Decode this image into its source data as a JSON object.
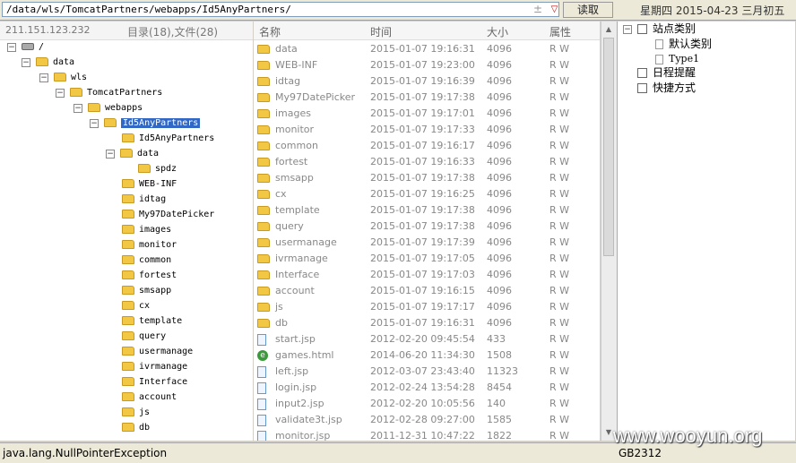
{
  "toolbar": {
    "path": "/data/wls/TomcatPartners/webapps/Id5AnyPartners/",
    "path_plus": "±",
    "dropdown_arrow": "▽",
    "read_button": "读取",
    "date": "星期四 2015-04-23 三月初五"
  },
  "left": {
    "ip": "211.151.123.232",
    "dir_info": "目录(18),文件(28)",
    "tree": [
      {
        "label": "/",
        "icon": "drive"
      },
      {
        "label": "data",
        "icon": "folder"
      },
      {
        "label": "wls",
        "icon": "folder"
      },
      {
        "label": "TomcatPartners",
        "icon": "folder"
      },
      {
        "label": "webapps",
        "icon": "folder"
      },
      {
        "label": "Id5AnyPartners",
        "icon": "folder",
        "selected": true
      },
      {
        "label": "Id5AnyPartners",
        "icon": "folder"
      },
      {
        "label": "data",
        "icon": "folder"
      },
      {
        "label": "spdz",
        "icon": "folder"
      },
      {
        "label": "WEB-INF",
        "icon": "folder"
      },
      {
        "label": "idtag",
        "icon": "folder"
      },
      {
        "label": "My97DatePicker",
        "icon": "folder"
      },
      {
        "label": "images",
        "icon": "folder"
      },
      {
        "label": "monitor",
        "icon": "folder"
      },
      {
        "label": "common",
        "icon": "folder"
      },
      {
        "label": "fortest",
        "icon": "folder"
      },
      {
        "label": "smsapp",
        "icon": "folder"
      },
      {
        "label": "cx",
        "icon": "folder"
      },
      {
        "label": "template",
        "icon": "folder"
      },
      {
        "label": "query",
        "icon": "folder"
      },
      {
        "label": "usermanage",
        "icon": "folder"
      },
      {
        "label": "ivrmanage",
        "icon": "folder"
      },
      {
        "label": "Interface",
        "icon": "folder"
      },
      {
        "label": "account",
        "icon": "folder"
      },
      {
        "label": "js",
        "icon": "folder"
      },
      {
        "label": "db",
        "icon": "folder"
      }
    ]
  },
  "files": {
    "columns": {
      "name": "名称",
      "time": "时间",
      "size": "大小",
      "attr": "属性"
    },
    "rows": [
      {
        "name": "data",
        "time": "2015-01-07 19:16:31",
        "size": "4096",
        "attr": "R W",
        "icon": "folder"
      },
      {
        "name": "WEB-INF",
        "time": "2015-01-07 19:23:00",
        "size": "4096",
        "attr": "R W",
        "icon": "folder"
      },
      {
        "name": "idtag",
        "time": "2015-01-07 19:16:39",
        "size": "4096",
        "attr": "R W",
        "icon": "folder"
      },
      {
        "name": "My97DatePicker",
        "time": "2015-01-07 19:17:38",
        "size": "4096",
        "attr": "R W",
        "icon": "folder"
      },
      {
        "name": "images",
        "time": "2015-01-07 19:17:01",
        "size": "4096",
        "attr": "R W",
        "icon": "folder"
      },
      {
        "name": "monitor",
        "time": "2015-01-07 19:17:33",
        "size": "4096",
        "attr": "R W",
        "icon": "folder"
      },
      {
        "name": "common",
        "time": "2015-01-07 19:16:17",
        "size": "4096",
        "attr": "R W",
        "icon": "folder"
      },
      {
        "name": "fortest",
        "time": "2015-01-07 19:16:33",
        "size": "4096",
        "attr": "R W",
        "icon": "folder"
      },
      {
        "name": "smsapp",
        "time": "2015-01-07 19:17:38",
        "size": "4096",
        "attr": "R W",
        "icon": "folder"
      },
      {
        "name": "cx",
        "time": "2015-01-07 19:16:25",
        "size": "4096",
        "attr": "R W",
        "icon": "folder"
      },
      {
        "name": "template",
        "time": "2015-01-07 19:17:38",
        "size": "4096",
        "attr": "R W",
        "icon": "folder"
      },
      {
        "name": "query",
        "time": "2015-01-07 19:17:38",
        "size": "4096",
        "attr": "R W",
        "icon": "folder"
      },
      {
        "name": "usermanage",
        "time": "2015-01-07 19:17:39",
        "size": "4096",
        "attr": "R W",
        "icon": "folder"
      },
      {
        "name": "ivrmanage",
        "time": "2015-01-07 19:17:05",
        "size": "4096",
        "attr": "R W",
        "icon": "folder"
      },
      {
        "name": "Interface",
        "time": "2015-01-07 19:17:03",
        "size": "4096",
        "attr": "R W",
        "icon": "folder"
      },
      {
        "name": "account",
        "time": "2015-01-07 19:16:15",
        "size": "4096",
        "attr": "R W",
        "icon": "folder"
      },
      {
        "name": "js",
        "time": "2015-01-07 19:17:17",
        "size": "4096",
        "attr": "R W",
        "icon": "folder"
      },
      {
        "name": "db",
        "time": "2015-01-07 19:16:31",
        "size": "4096",
        "attr": "R W",
        "icon": "folder"
      },
      {
        "name": "start.jsp",
        "time": "2012-02-20 09:45:54",
        "size": "433",
        "attr": "R W",
        "icon": "file"
      },
      {
        "name": "games.html",
        "time": "2014-06-20 11:34:30",
        "size": "1508",
        "attr": "R W",
        "icon": "ie"
      },
      {
        "name": "left.jsp",
        "time": "2012-03-07 23:43:40",
        "size": "11323",
        "attr": "R W",
        "icon": "file"
      },
      {
        "name": "login.jsp",
        "time": "2012-02-24 13:54:28",
        "size": "8454",
        "attr": "R W",
        "icon": "file"
      },
      {
        "name": "input2.jsp",
        "time": "2012-02-20 10:05:56",
        "size": "140",
        "attr": "R W",
        "icon": "file"
      },
      {
        "name": "validate3t.jsp",
        "time": "2012-02-28 09:27:00",
        "size": "1585",
        "attr": "R W",
        "icon": "file"
      },
      {
        "name": "monitor.jsp",
        "time": "2011-12-31 10:47:22",
        "size": "1822",
        "attr": "R W",
        "icon": "file"
      }
    ]
  },
  "right": {
    "site_category": "站点类别",
    "default_category": "默认类别",
    "type1": "Type1",
    "schedule": "日程提醒",
    "shortcuts": "快捷方式"
  },
  "status": {
    "message": "java.lang.NullPointerException",
    "encoding": "GB2312",
    "watermark": "www.wooyun.org"
  }
}
